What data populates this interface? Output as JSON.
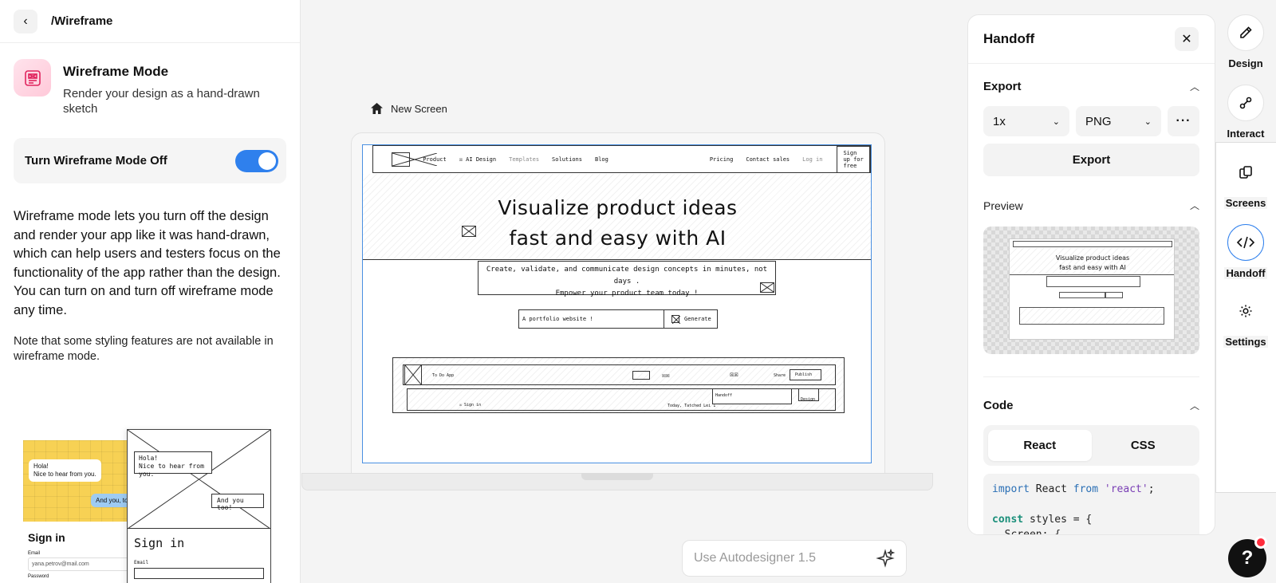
{
  "header": {
    "breadcrumb": "/Wireframe"
  },
  "wireframe": {
    "title": "Wireframe Mode",
    "subtitle": "Render your design as a hand-drawn sketch",
    "toggle_label": "Turn Wireframe Mode Off",
    "toggle_on": true,
    "description_1": "Wireframe mode lets you turn off the design and render your app like it was hand-drawn, which can help users and testers focus on the functionality of the app rather than the design.",
    "description_2": "You can turn on and turn off wireframe mode any time.",
    "note": "Note that some styling features are not available in wireframe mode.",
    "sample_color": {
      "bubble1_line1": "Hola!",
      "bubble1_line2": "Nice to hear from you.",
      "bubble2": "And you, to",
      "signin": "Sign in",
      "email_label": "Email",
      "email_value": "yana.petrov@mail.com",
      "password_label": "Password"
    },
    "sample_sketch": {
      "bubble1_line1": "Hola!",
      "bubble1_line2": "Nice to hear from you.",
      "bubble2": "And you too!",
      "signin": "Sign in",
      "email_label": "Email"
    }
  },
  "canvas": {
    "screen_name": "New Screen",
    "nav": {
      "items": [
        "Product",
        "AI Design",
        "Templates",
        "Solutions",
        "Blog"
      ],
      "right_items": [
        "Pricing",
        "Contact sales",
        "Log in"
      ],
      "signup": "Sign up for free"
    },
    "hero_line1": "Visualize product ideas",
    "hero_line2": "fast and easy with AI",
    "sub_line1": "Create, validate, and communicate design concepts in minutes, not days .",
    "sub_line2": "Empower your product team today !",
    "input_value": "A portfolio website !",
    "generate": "Generate",
    "device": {
      "title": "To Do App",
      "publish": "Publish",
      "share": "Share",
      "handoff": "Handoff",
      "design": "Design",
      "sign_in": "Sign in",
      "today": "Today, Tatched Lei 1"
    }
  },
  "handoff": {
    "title": "Handoff",
    "export_title": "Export",
    "scale": "1x",
    "format": "PNG",
    "export_button": "Export",
    "preview_title": "Preview",
    "code_title": "Code",
    "tabs": [
      "React",
      "CSS"
    ],
    "code": {
      "line1_kw": "import",
      "line1_mid": " React ",
      "line1_from": "from",
      "line1_str": "'react'",
      "line1_end": ";",
      "line2_kw": "const",
      "line2_rest": " styles = {",
      "line3": "  Screen: {"
    }
  },
  "rail": {
    "items": [
      {
        "label": "Design",
        "icon": "pencil-icon"
      },
      {
        "label": "Interact",
        "icon": "interact-icon"
      },
      {
        "label": "Screens",
        "icon": "screens-icon"
      },
      {
        "label": "Handoff",
        "icon": "code-icon"
      },
      {
        "label": "Settings",
        "icon": "gear-icon"
      }
    ],
    "active": "Handoff"
  },
  "prompt": {
    "placeholder": "Use Autodesigner 1.5"
  },
  "help": {
    "label": "?"
  },
  "colors": {
    "accent": "#2f80ed",
    "notification": "#ff2d3d"
  }
}
